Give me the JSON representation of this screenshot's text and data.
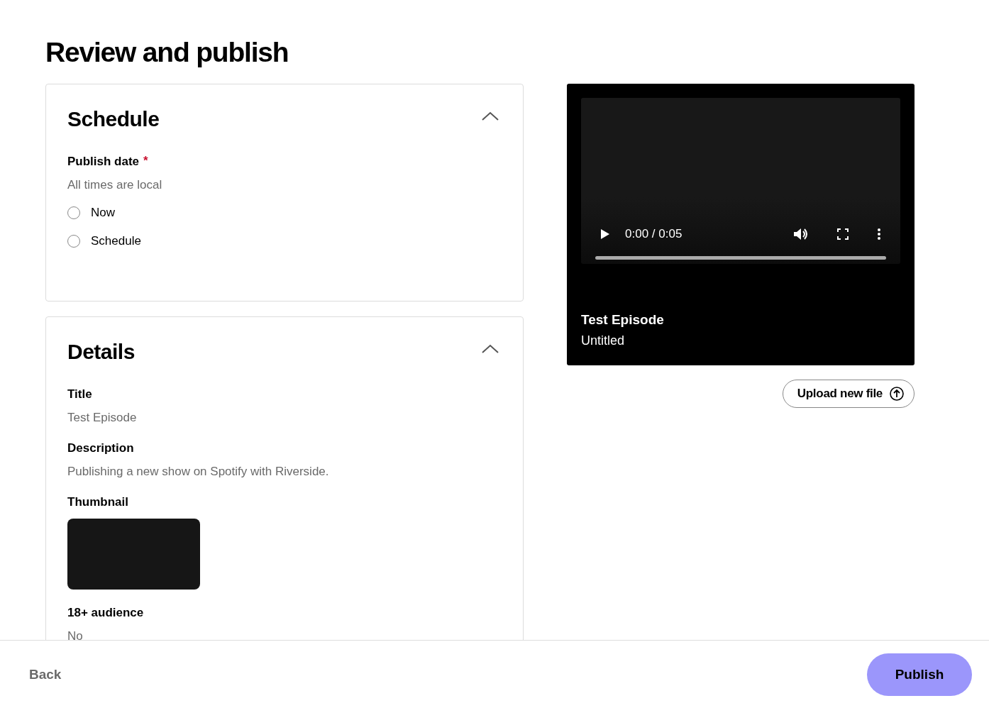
{
  "page_title": "Review and publish",
  "sections": [
    {
      "kind": "schedule",
      "title": "Schedule",
      "expanded": true,
      "label": "Publish date",
      "required_mark": "*",
      "hint": "All times are local",
      "options": [
        {
          "label": "Now",
          "selected": false
        },
        {
          "label": "Schedule",
          "selected": false
        }
      ]
    },
    {
      "kind": "details",
      "title": "Details",
      "expanded": true,
      "fields": [
        {
          "kind": "text",
          "label": "Title",
          "value": "Test Episode"
        },
        {
          "kind": "text",
          "label": "Description",
          "value": "Publishing a new show on Spotify with Riverside."
        },
        {
          "kind": "thumbnail",
          "label": "Thumbnail"
        },
        {
          "kind": "text",
          "label": "18+ audience",
          "value": "No"
        }
      ]
    }
  ],
  "player": {
    "time": "0:00 / 0:05",
    "level": 0,
    "title": "Test Episode",
    "subtitle": "Untitled"
  },
  "upload_button": "Upload new file",
  "footer": {
    "back": "Back",
    "publish": "Publish"
  }
}
